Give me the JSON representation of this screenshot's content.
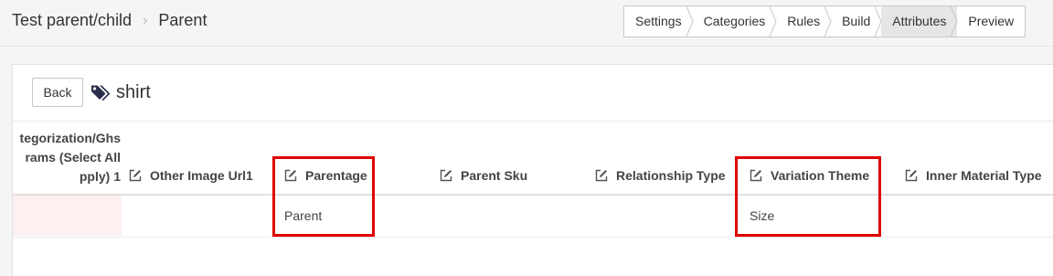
{
  "breadcrumb": {
    "parent": "Test parent/child",
    "current": "Parent"
  },
  "steps": [
    "Settings",
    "Categories",
    "Rules",
    "Build",
    "Attributes",
    "Preview"
  ],
  "active_step": "Attributes",
  "back_label": "Back",
  "tag_title": "shirt",
  "partial_header": [
    "tegorization/Ghs",
    "rams (Select All",
    "pply) 1"
  ],
  "columns": {
    "other_image_url": "Other Image Url1",
    "parentage": "Parentage",
    "parent_sku": "Parent Sku",
    "relationship_type": "Relationship Type",
    "variation_theme": "Variation Theme",
    "inner_material_type": "Inner Material Type"
  },
  "row": {
    "parentage": "Parent",
    "variation_theme": "Size"
  },
  "colors": {
    "highlight": "#e00000",
    "active_step_bg": "#e6e6e6",
    "error_cell_bg": "#fdf0f0"
  }
}
